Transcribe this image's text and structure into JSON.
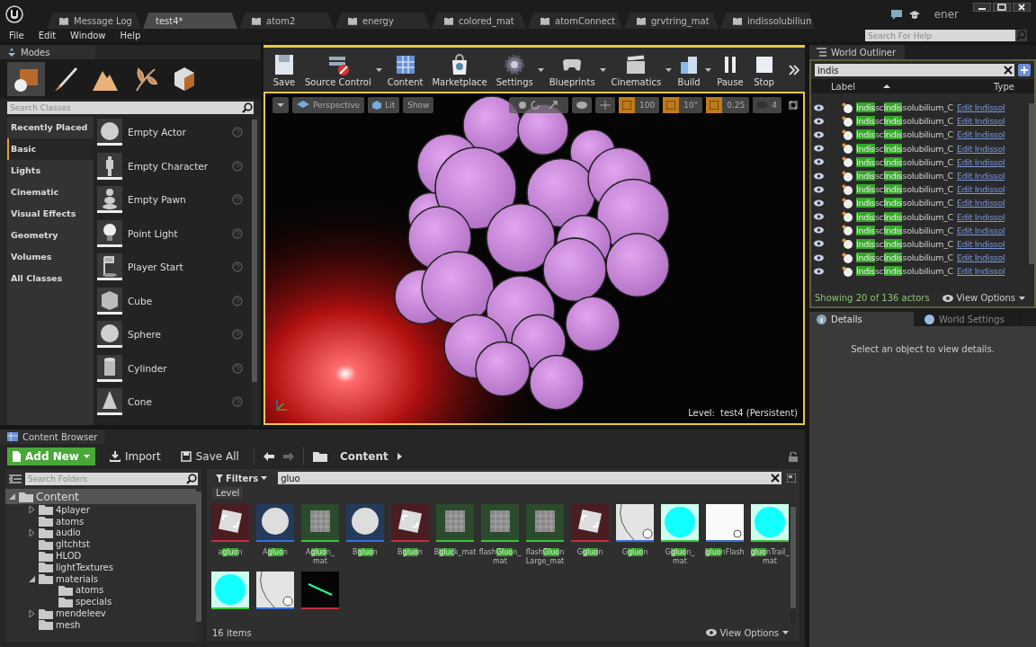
{
  "doc_tabs": [
    {
      "label": "Message Log",
      "selected": false
    },
    {
      "label": "test4*",
      "selected": true
    },
    {
      "label": "atom2",
      "selected": false
    },
    {
      "label": "energy",
      "selected": false
    },
    {
      "label": "colored_mat",
      "selected": false
    },
    {
      "label": "atomConnect",
      "selected": false
    },
    {
      "label": "grvtring_mat",
      "selected": false
    },
    {
      "label": "indissolubilium",
      "selected": false
    }
  ],
  "user_badge": "ener",
  "menu": [
    "File",
    "Edit",
    "Window",
    "Help"
  ],
  "help_search": {
    "placeholder": "Search For Help"
  },
  "modes": {
    "title": "Modes",
    "tools": [
      {
        "selected": true
      },
      {
        "selected": false
      },
      {
        "selected": false
      },
      {
        "selected": false
      },
      {
        "selected": false
      }
    ],
    "search": {
      "placeholder": "Search Classes"
    },
    "categories": [
      {
        "label": "Recently Placed",
        "selected": false
      },
      {
        "label": "Basic",
        "selected": true
      },
      {
        "label": "Lights",
        "selected": false
      },
      {
        "label": "Cinematic",
        "selected": false
      },
      {
        "label": "Visual Effects",
        "selected": false
      },
      {
        "label": "Geometry",
        "selected": false
      },
      {
        "label": "Volumes",
        "selected": false
      },
      {
        "label": "All Classes",
        "selected": false
      }
    ],
    "items": [
      {
        "label": "Empty Actor",
        "kind": "sphere"
      },
      {
        "label": "Empty Character",
        "kind": "figure"
      },
      {
        "label": "Empty Pawn",
        "kind": "pawn"
      },
      {
        "label": "Point Light",
        "kind": "bulb"
      },
      {
        "label": "Player Start",
        "kind": "flag"
      },
      {
        "label": "Cube",
        "kind": "cube"
      },
      {
        "label": "Sphere",
        "kind": "sphere"
      },
      {
        "label": "Cylinder",
        "kind": "cylinder"
      },
      {
        "label": "Cone",
        "kind": "cone"
      }
    ]
  },
  "toolbar": [
    {
      "label": "Save",
      "dropdown": false
    },
    {
      "label": "Source Control",
      "dropdown": true
    },
    {
      "label": "Content",
      "dropdown": false
    },
    {
      "label": "Marketplace",
      "dropdown": false
    },
    {
      "label": "Settings",
      "dropdown": true
    },
    {
      "label": "Blueprints",
      "dropdown": true
    },
    {
      "label": "Cinematics",
      "dropdown": true
    },
    {
      "label": "Build",
      "dropdown": true
    },
    {
      "label": "Pause",
      "dropdown": false
    },
    {
      "label": "Stop",
      "dropdown": false
    }
  ],
  "viewport": {
    "view_mode": "Perspective",
    "lighting": "Lit",
    "show": "Show",
    "grid_snap": {
      "on": true,
      "value": "100"
    },
    "rotation_snap": {
      "on": true,
      "value": "10°"
    },
    "scale_snap": {
      "on": true,
      "value": "0.25"
    },
    "camera_speed": "4",
    "level_label": "Level:",
    "level_name": "test4 (Persistent)"
  },
  "world_outliner": {
    "title": "World Outliner",
    "search": {
      "value": "indis"
    },
    "columns": [
      "Label",
      "Type"
    ],
    "rows": [
      {
        "label": [
          {
            "text": "Indis",
            "highlight": true
          },
          {
            "text": "sc",
            "highlight": false
          },
          {
            "text": "Indis",
            "highlight": true
          },
          {
            "text": "solubilium_C",
            "highlight": false
          }
        ],
        "type": "Edit Indissol"
      },
      {
        "label": [
          {
            "text": "Indis",
            "highlight": true
          },
          {
            "text": "sc",
            "highlight": false
          },
          {
            "text": "Indis",
            "highlight": true
          },
          {
            "text": "solubilium_C",
            "highlight": false
          }
        ],
        "type": "Edit Indissol"
      },
      {
        "label": [
          {
            "text": "Indis",
            "highlight": true
          },
          {
            "text": "sc",
            "highlight": false
          },
          {
            "text": "Indis",
            "highlight": true
          },
          {
            "text": "solubilium_C",
            "highlight": false
          }
        ],
        "type": "Edit Indissol"
      },
      {
        "label": [
          {
            "text": "Indis",
            "highlight": true
          },
          {
            "text": "sc",
            "highlight": false
          },
          {
            "text": "Indis",
            "highlight": true
          },
          {
            "text": "solubilium_C",
            "highlight": false
          }
        ],
        "type": "Edit Indissol"
      },
      {
        "label": [
          {
            "text": "Indis",
            "highlight": true
          },
          {
            "text": "sc",
            "highlight": false
          },
          {
            "text": "Indis",
            "highlight": true
          },
          {
            "text": "solubilium_C",
            "highlight": false
          }
        ],
        "type": "Edit Indissol"
      },
      {
        "label": [
          {
            "text": "Indis",
            "highlight": true
          },
          {
            "text": "sc",
            "highlight": false
          },
          {
            "text": "Indis",
            "highlight": true
          },
          {
            "text": "solubilium_C",
            "highlight": false
          }
        ],
        "type": "Edit Indissol"
      },
      {
        "label": [
          {
            "text": "Indis",
            "highlight": true
          },
          {
            "text": "sc",
            "highlight": false
          },
          {
            "text": "Indis",
            "highlight": true
          },
          {
            "text": "solubilium_C",
            "highlight": false
          }
        ],
        "type": "Edit Indissol"
      },
      {
        "label": [
          {
            "text": "Indis",
            "highlight": true
          },
          {
            "text": "sc",
            "highlight": false
          },
          {
            "text": "Indis",
            "highlight": true
          },
          {
            "text": "solubilium_C",
            "highlight": false
          }
        ],
        "type": "Edit Indissol"
      },
      {
        "label": [
          {
            "text": "Indis",
            "highlight": true
          },
          {
            "text": "sc",
            "highlight": false
          },
          {
            "text": "Indis",
            "highlight": true
          },
          {
            "text": "solubilium_C",
            "highlight": false
          }
        ],
        "type": "Edit Indissol"
      },
      {
        "label": [
          {
            "text": "Indis",
            "highlight": true
          },
          {
            "text": "sc",
            "highlight": false
          },
          {
            "text": "Indis",
            "highlight": true
          },
          {
            "text": "solubilium_C",
            "highlight": false
          }
        ],
        "type": "Edit Indissol"
      },
      {
        "label": [
          {
            "text": "Indis",
            "highlight": true
          },
          {
            "text": "sc",
            "highlight": false
          },
          {
            "text": "Indis",
            "highlight": true
          },
          {
            "text": "solubilium_C",
            "highlight": false
          }
        ],
        "type": "Edit Indissol"
      },
      {
        "label": [
          {
            "text": "Indis",
            "highlight": true
          },
          {
            "text": "sc",
            "highlight": false
          },
          {
            "text": "Indis",
            "highlight": true
          },
          {
            "text": "solubilium_C",
            "highlight": false
          }
        ],
        "type": "Edit Indissol"
      },
      {
        "label": [
          {
            "text": "Indis",
            "highlight": true
          },
          {
            "text": "sc",
            "highlight": false
          },
          {
            "text": "Indis",
            "highlight": true
          },
          {
            "text": "solubilium_C",
            "highlight": false
          }
        ],
        "type": "Edit Indissol"
      }
    ],
    "status": "Showing 20 of 136 actors",
    "view_options": "View Options"
  },
  "details_tabs": [
    {
      "label": "Details",
      "selected": true
    },
    {
      "label": "World Settings",
      "selected": false
    }
  ],
  "details_message": "Select an object to view details.",
  "content_browser": {
    "title": "Content Browser",
    "add_new": "Add New",
    "import": "Import",
    "save_all": "Save All",
    "path": "Content",
    "folder_search": {
      "placeholder": "Search Folders"
    },
    "folders": [
      {
        "label": "Content",
        "selected": true,
        "expanded": true,
        "children": [
          {
            "label": "4player",
            "selected": false,
            "expanded": false
          },
          {
            "label": "atoms",
            "selected": false
          },
          {
            "label": "audio",
            "selected": false,
            "expanded": false
          },
          {
            "label": "gltchtst",
            "selected": false
          },
          {
            "label": "HLOD",
            "selected": false
          },
          {
            "label": "lightTextures",
            "selected": false
          },
          {
            "label": "materials",
            "selected": false,
            "expanded": true,
            "children": [
              {
                "label": "atoms",
                "selected": false
              },
              {
                "label": "specials",
                "selected": false
              }
            ]
          },
          {
            "label": "mendeleev",
            "selected": false,
            "expanded": false
          },
          {
            "label": "mesh",
            "selected": false
          }
        ]
      }
    ],
    "filters": "Filters",
    "search": {
      "value": "gluo"
    },
    "filter_chip": "Level",
    "assets": [
      {
        "kind": "texture",
        "color": "#c0303a",
        "name": [
          {
            "text": "a",
            "highlight": false
          },
          {
            "text": "gluo",
            "highlight": true
          },
          {
            "text": "n",
            "highlight": false
          }
        ]
      },
      {
        "kind": "sphere",
        "color": "#3a6fd8",
        "name": [
          {
            "text": "A",
            "highlight": false
          },
          {
            "text": "gluo",
            "highlight": true
          },
          {
            "text": "n",
            "highlight": false
          }
        ]
      },
      {
        "kind": "material",
        "color": "#3cc23c",
        "name": [
          {
            "text": "A",
            "highlight": false
          },
          {
            "text": "gluo",
            "highlight": true
          },
          {
            "text": "n_ mat",
            "highlight": false
          }
        ]
      },
      {
        "kind": "sphere",
        "color": "#3a6fd8",
        "name": [
          {
            "text": "B",
            "highlight": false
          },
          {
            "text": "gluo",
            "highlight": true
          },
          {
            "text": "n",
            "highlight": false
          }
        ]
      },
      {
        "kind": "texture",
        "color": "#c0303a",
        "name": [
          {
            "text": "B",
            "highlight": false
          },
          {
            "text": "gluo",
            "highlight": true
          },
          {
            "text": "n",
            "highlight": false
          }
        ]
      },
      {
        "kind": "material",
        "color": "#3cc23c",
        "name": [
          {
            "text": "B",
            "highlight": false
          },
          {
            "text": "gluc",
            "highlight": true
          },
          {
            "text": "k_mat",
            "highlight": false
          }
        ]
      },
      {
        "kind": "material",
        "color": "#3cc23c",
        "name": [
          {
            "text": "flash",
            "highlight": false
          },
          {
            "text": "Gluo",
            "highlight": true
          },
          {
            "text": "n_ mat",
            "highlight": false
          }
        ]
      },
      {
        "kind": "material",
        "color": "#3cc23c",
        "name": [
          {
            "text": "flash",
            "highlight": false
          },
          {
            "text": "Gluo",
            "highlight": true
          },
          {
            "text": "n Large_mat",
            "highlight": false
          }
        ]
      },
      {
        "kind": "texture",
        "color": "#c0303a",
        "name": [
          {
            "text": "G",
            "highlight": false
          },
          {
            "text": "gluo",
            "highlight": true
          },
          {
            "text": "n",
            "highlight": false
          }
        ]
      },
      {
        "kind": "white_sphere",
        "color": "#3a6fd8",
        "name": [
          {
            "text": "G",
            "highlight": false
          },
          {
            "text": "gluo",
            "highlight": true
          },
          {
            "text": "n",
            "highlight": false
          }
        ]
      },
      {
        "kind": "cyan",
        "color": "#3cc23c",
        "name": [
          {
            "text": "G",
            "highlight": false
          },
          {
            "text": "gluo",
            "highlight": true
          },
          {
            "text": "n_ mat",
            "highlight": false
          }
        ]
      },
      {
        "kind": "white",
        "color": "#3a6fd8",
        "name": [
          {
            "text": "gluo",
            "highlight": true
          },
          {
            "text": "nFlash",
            "highlight": false
          }
        ]
      },
      {
        "kind": "cyan",
        "color": "#3cc23c",
        "name": [
          {
            "text": "gluo",
            "highlight": true
          },
          {
            "text": "nTrail_ mat",
            "highlight": false
          }
        ]
      },
      {
        "kind": "cyan",
        "color": "#3cc23c"
      },
      {
        "kind": "white_sphere",
        "color": "#3a6fd8"
      },
      {
        "kind": "particle",
        "color": "#c0303a"
      }
    ],
    "item_count": "16 items",
    "view_options": "View Options"
  }
}
